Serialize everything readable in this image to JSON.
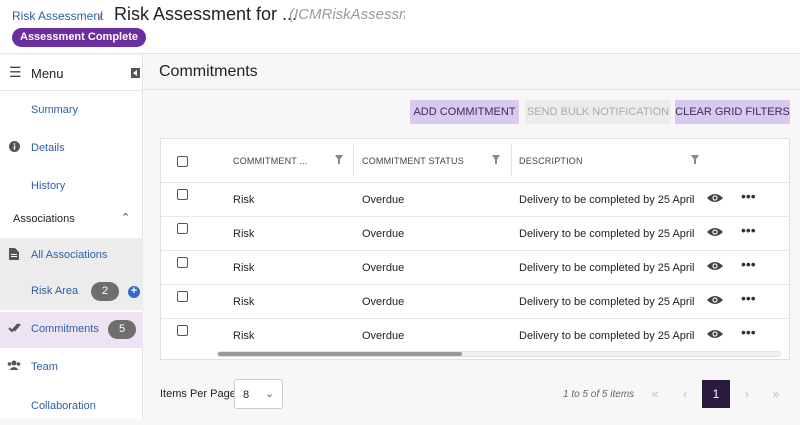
{
  "header": {
    "breadcrumb": "Risk Assessment",
    "separator": "/",
    "title": "Risk Assessment for ...",
    "subtitle": "(ICMRiskAssessme",
    "status": "Assessment Complete"
  },
  "sidebar": {
    "menu_label": "Menu",
    "items": [
      {
        "label": "Summary"
      },
      {
        "label": "Details"
      },
      {
        "label": "History"
      }
    ],
    "associations_header": "Associations",
    "assoc_items": [
      {
        "label": "All Associations"
      },
      {
        "label": "Risk Area",
        "count": "2"
      },
      {
        "label": "Commitments",
        "count": "5"
      },
      {
        "label": "Team"
      },
      {
        "label": "Collaboration"
      }
    ]
  },
  "main": {
    "title": "Commitments",
    "buttons": {
      "add": "ADD COMMITMENT",
      "bulk": "SEND BULK NOTIFICATION",
      "clear": "CLEAR GRID FILTERS"
    },
    "columns": [
      "COMMITMENT ...",
      "COMMITMENT STATUS",
      "DESCRIPTION"
    ],
    "rows": [
      {
        "commitment": "Risk",
        "status": "Overdue",
        "description": "Delivery to be completed by 25 April ..."
      },
      {
        "commitment": "Risk",
        "status": "Overdue",
        "description": "Delivery to be completed by 25 April ..."
      },
      {
        "commitment": "Risk",
        "status": "Overdue",
        "description": "Delivery to be completed by 25 April ..."
      },
      {
        "commitment": "Risk",
        "status": "Overdue",
        "description": "Delivery to be completed by 25 April ..."
      },
      {
        "commitment": "Risk",
        "status": "Overdue",
        "description": "Delivery to be completed by 25 April ..."
      }
    ],
    "row_menu": "•••"
  },
  "pager": {
    "items_per_page_label": "Items Per Page",
    "page_size": "8",
    "range": "1 to 5 of 5 items",
    "first": "«",
    "prev": "‹",
    "current": "1",
    "next": "›",
    "last": "»"
  },
  "colors": {
    "accent": "#6b2f9e",
    "button_primary_bg": "#d9c9ee",
    "link": "#2f5fa7",
    "active_page": "#2a1a3d"
  }
}
